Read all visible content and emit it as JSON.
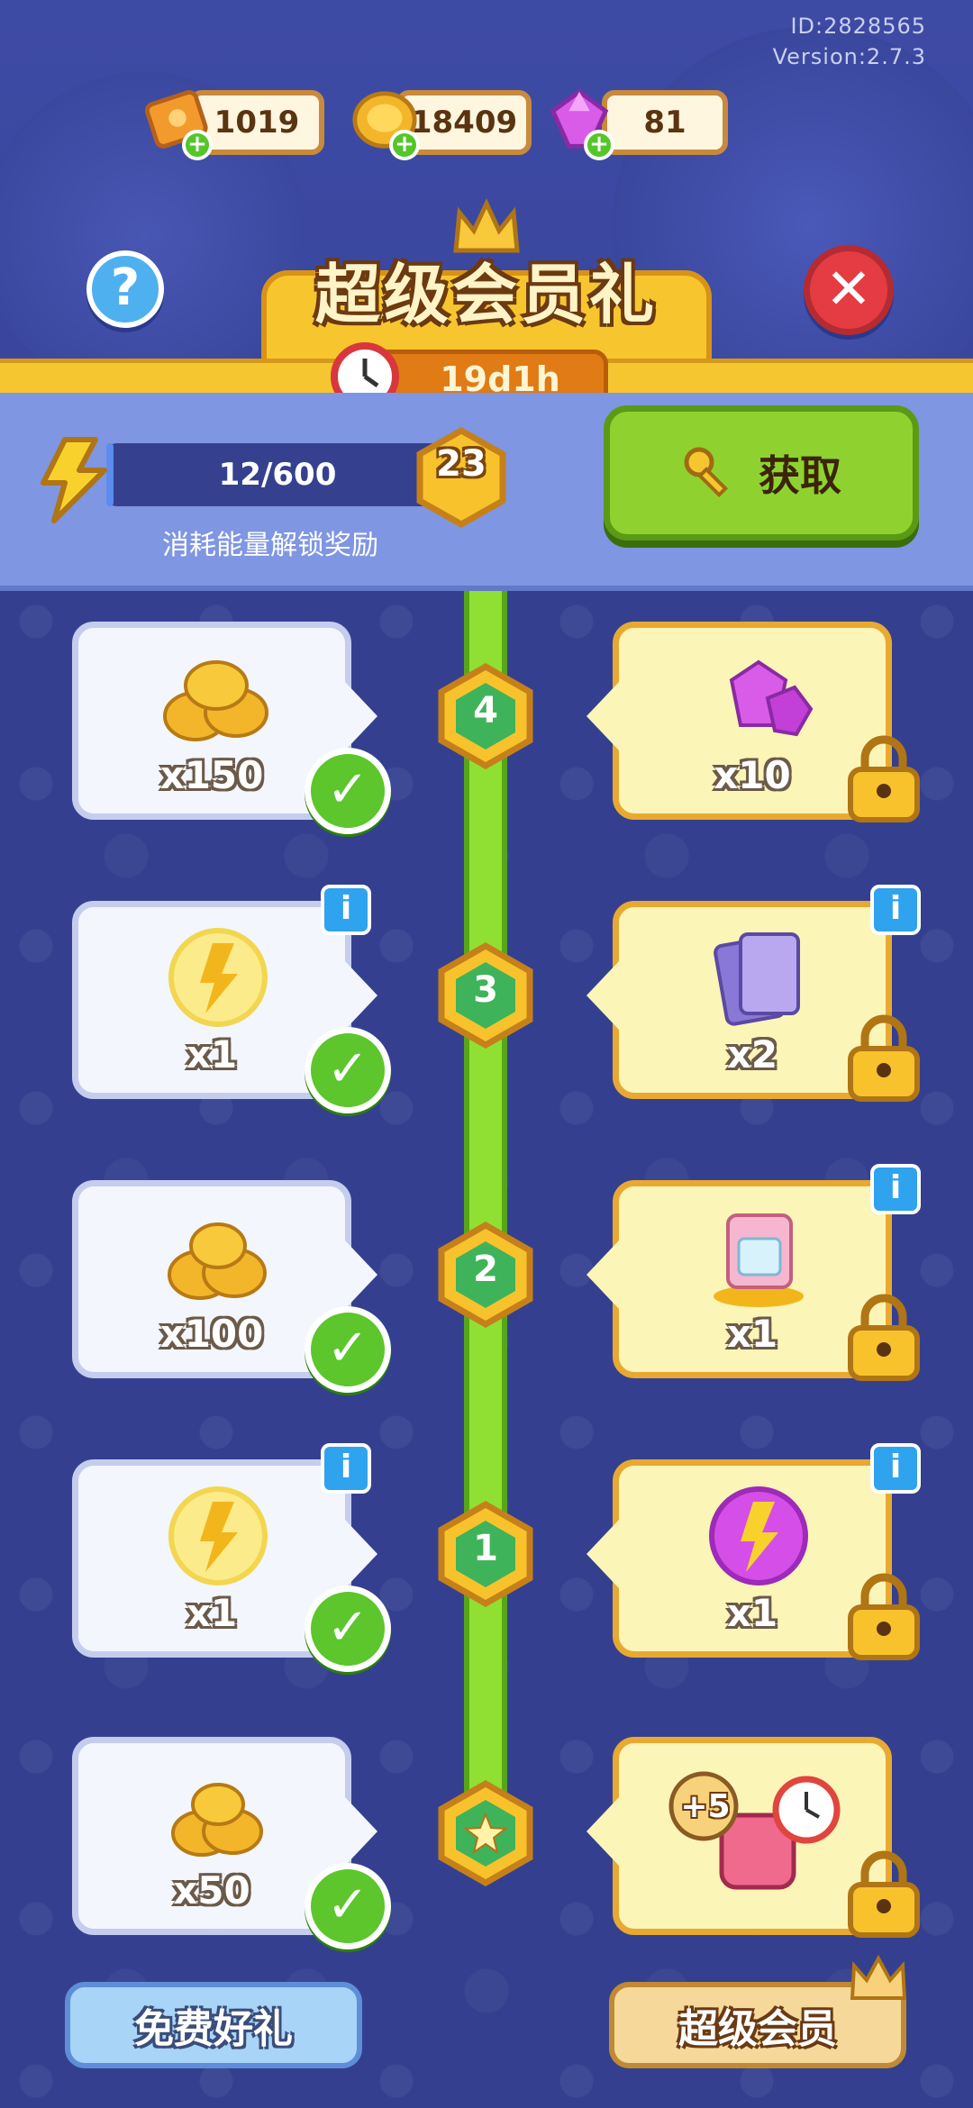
{
  "header": {
    "id_text": "ID:2828565",
    "version_text": "Version:2.7.3"
  },
  "currency": [
    {
      "icon": "ticket-icon",
      "value": "1019"
    },
    {
      "icon": "coin-icon",
      "value": "18409"
    },
    {
      "icon": "gem-icon",
      "value": "81"
    }
  ],
  "title": "超级会员礼",
  "timer": "19d1h",
  "energy": {
    "progress_text": "12/600",
    "progress_fraction": 0.02,
    "level": "23",
    "caption": "消耗能量解锁奖励"
  },
  "get_button": {
    "label": "获取"
  },
  "tiers": [
    {
      "level": "4",
      "free": {
        "item": "coins",
        "qty": "x150",
        "claimed": true
      },
      "vip": {
        "item": "gems",
        "qty": "x10",
        "locked": true
      }
    },
    {
      "level": "3",
      "free": {
        "item": "energy-orb",
        "qty": "x1",
        "claimed": true,
        "info": true
      },
      "vip": {
        "item": "cards",
        "qty": "x2",
        "locked": true,
        "info": true
      }
    },
    {
      "level": "2",
      "free": {
        "item": "coins",
        "qty": "x100",
        "claimed": true
      },
      "vip": {
        "item": "decor",
        "qty": "x1",
        "locked": true,
        "info": true
      }
    },
    {
      "level": "1",
      "free": {
        "item": "energy-orb",
        "qty": "x1",
        "claimed": true,
        "info": true
      },
      "vip": {
        "item": "super-energy-orb",
        "qty": "x1",
        "locked": true,
        "info": true
      }
    },
    {
      "level": "star",
      "free": {
        "item": "coins",
        "qty": "x50",
        "claimed": true
      },
      "vip": {
        "item": "bundle",
        "qty": "+5",
        "locked": true
      }
    }
  ],
  "bottom": {
    "free_label": "免费好礼",
    "vip_label": "超级会员"
  },
  "colors": {
    "accent_green": "#8fd230",
    "gold": "#f6c631",
    "panel_blue": "#7f96e2"
  }
}
